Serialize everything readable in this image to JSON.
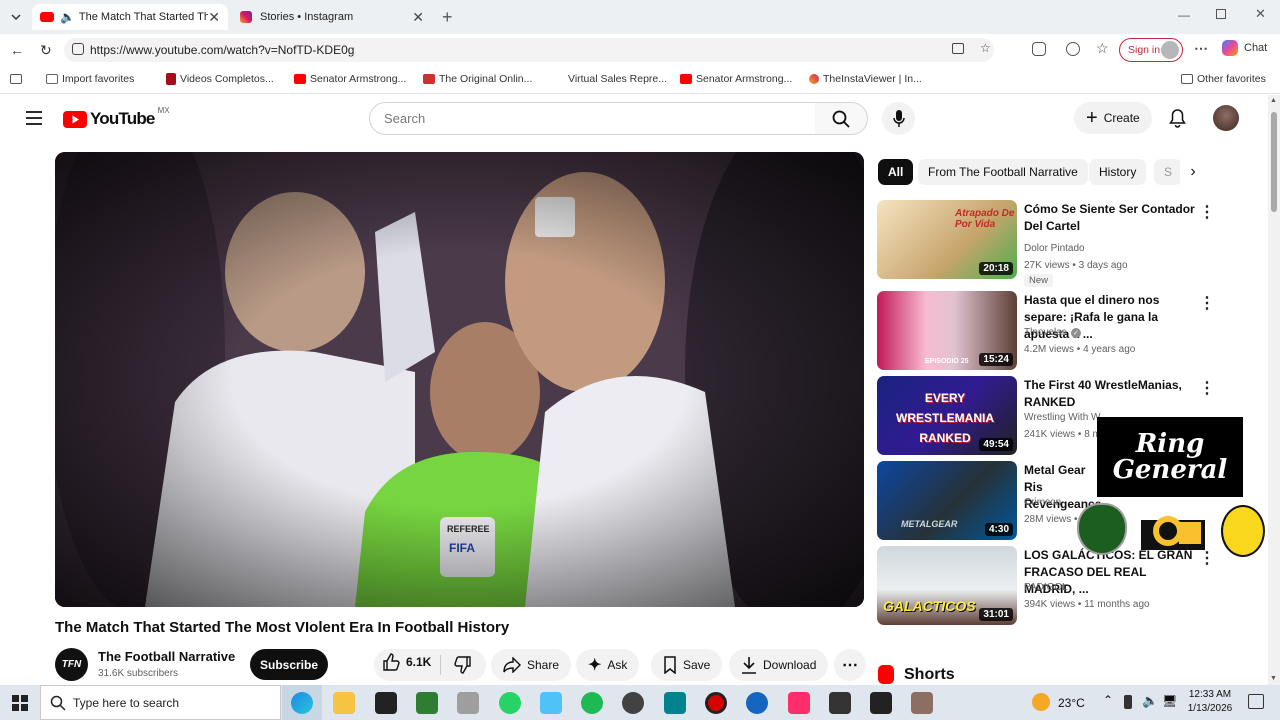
{
  "browser": {
    "tabs": [
      {
        "title": "The Match That Started The M",
        "active": true
      },
      {
        "title": "Stories • Instagram",
        "active": false
      }
    ],
    "url": "https://www.youtube.com/watch?v=NofTD-KDE0g",
    "sign_in": "Sign in",
    "chat": "Chat",
    "bookmarks": [
      "Import favorites",
      "Videos Completos...",
      "Senator Armstrong...",
      "The Original Onlin...",
      "Virtual Sales Repre...",
      "Senator Armstrong...",
      "TheInstaViewer | In..."
    ],
    "other_favorites": "Other favorites"
  },
  "youtube": {
    "logo_text": "YouTube",
    "region": "MX",
    "search_placeholder": "Search",
    "create_label": "Create",
    "video_title": "The Match That Started The Most VIolent Era In Football History",
    "channel": {
      "name": "The Football Narrative",
      "subscribers": "31.6K subscribers",
      "avatar_text": "TFN"
    },
    "subscribe_label": "Subscribe",
    "actions": {
      "likes": "6.1K",
      "share": "Share",
      "ask": "Ask",
      "save": "Save",
      "download": "Download"
    },
    "chips": [
      "All",
      "From The Football Narrative",
      "History",
      "S"
    ],
    "recommendations": [
      {
        "title": "Cómo Se Siente Ser Contador Del Cartel",
        "channel": "Dolor Pintado",
        "meta": "27K views • 3 days ago",
        "badge": "New",
        "duration": "20:18",
        "thumb_text": "Atrapado De Por Vida"
      },
      {
        "title": "Hasta que el dinero nos separe: ¡Rafa le gana la apuesta a ...",
        "channel": "Tlnovelas",
        "meta": "4.2M views • 4 years ago",
        "duration": "15:24",
        "thumb_text": "EPISODIO 25"
      },
      {
        "title": "The First 40 WrestleManias, RANKED",
        "channel": "Wrestling With W",
        "meta": "241K views • 8 m",
        "duration": "49:54",
        "thumb_text": "EVERY WRESTLEMANIA RANKED"
      },
      {
        "title": "Metal Gear Ris Revengeance",
        "channel": "Crimson",
        "meta": "28M views •",
        "duration": "4:30",
        "thumb_text": "METALGEAR"
      },
      {
        "title": "LOS GALÁCTICOS: EL GRAN FRACASO DEL REAL MADRID, ...",
        "channel": "PADIGOL",
        "meta": "394K views • 11 months ago",
        "duration": "31:01",
        "thumb_text": "GALACTICOS"
      }
    ],
    "shorts_label": "Shorts",
    "overlay_logo": "Ring General",
    "video_overlay_text": [
      "REFEREE",
      "FIFA"
    ]
  },
  "taskbar": {
    "search_placeholder": "Type here to search",
    "weather": "23°C",
    "time": "12:33 AM",
    "date": "1/13/2026"
  },
  "colors": {
    "youtube_red": "#ff0000",
    "subscribe_bg": "#0f0f0f",
    "sign_in_red": "#c4263b"
  }
}
